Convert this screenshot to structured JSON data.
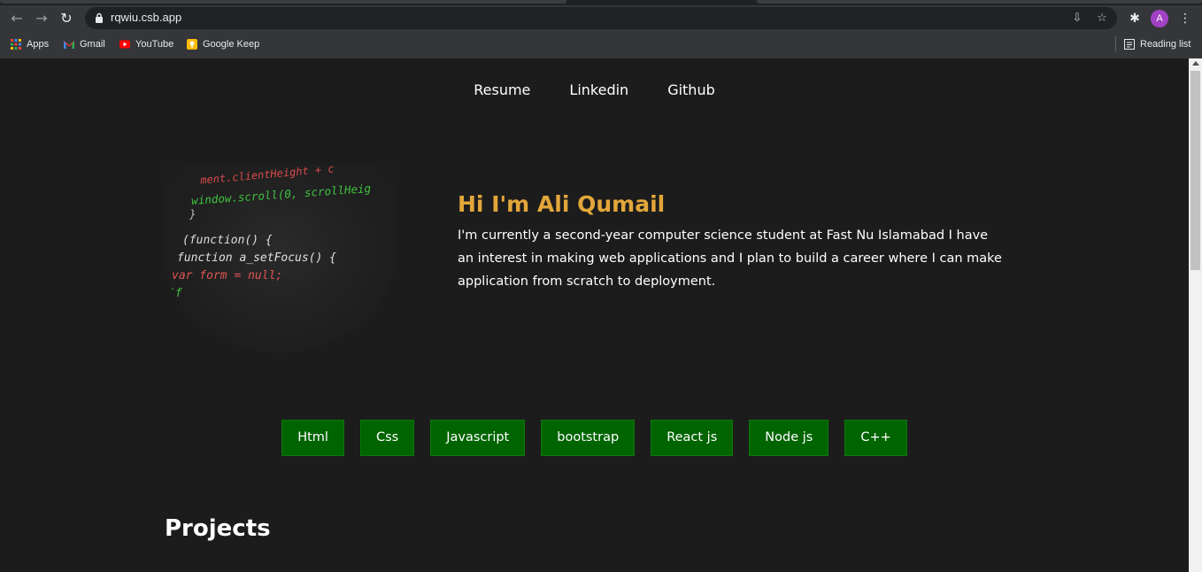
{
  "browser": {
    "url": "rqwiu.csb.app",
    "avatar_letter": "A",
    "bookmarks": [
      {
        "label": "Apps",
        "icon": "apps-grid-icon"
      },
      {
        "label": "Gmail",
        "icon": "gmail-icon"
      },
      {
        "label": "YouTube",
        "icon": "youtube-icon"
      },
      {
        "label": "Google Keep",
        "icon": "keep-icon"
      }
    ],
    "reading_list": "Reading list"
  },
  "nav": {
    "items": [
      "Resume",
      "Linkedin",
      "Github"
    ]
  },
  "hero": {
    "title": "Hi I'm Ali Qumail",
    "description": "I'm currently a second-year computer science student at Fast Nu Islamabad I have an interest in making web applications and I plan to build a career where I can make application from scratch to deployment.",
    "code_lines": [
      "ment.clientHeight + c",
      "window.scroll(0, scrollHeig",
      "}",
      "(function() {",
      "function a_setFocus() {",
      "var form = null;",
      "if"
    ]
  },
  "skills": [
    "Html",
    "Css",
    "Javascript",
    "bootstrap",
    "React js",
    "Node js",
    "C++"
  ],
  "sections": {
    "projects_title": "Projects"
  },
  "colors": {
    "page_bg": "#1c1c1c",
    "title_accent": "#e2a63a",
    "skill_bg": "#006400"
  }
}
